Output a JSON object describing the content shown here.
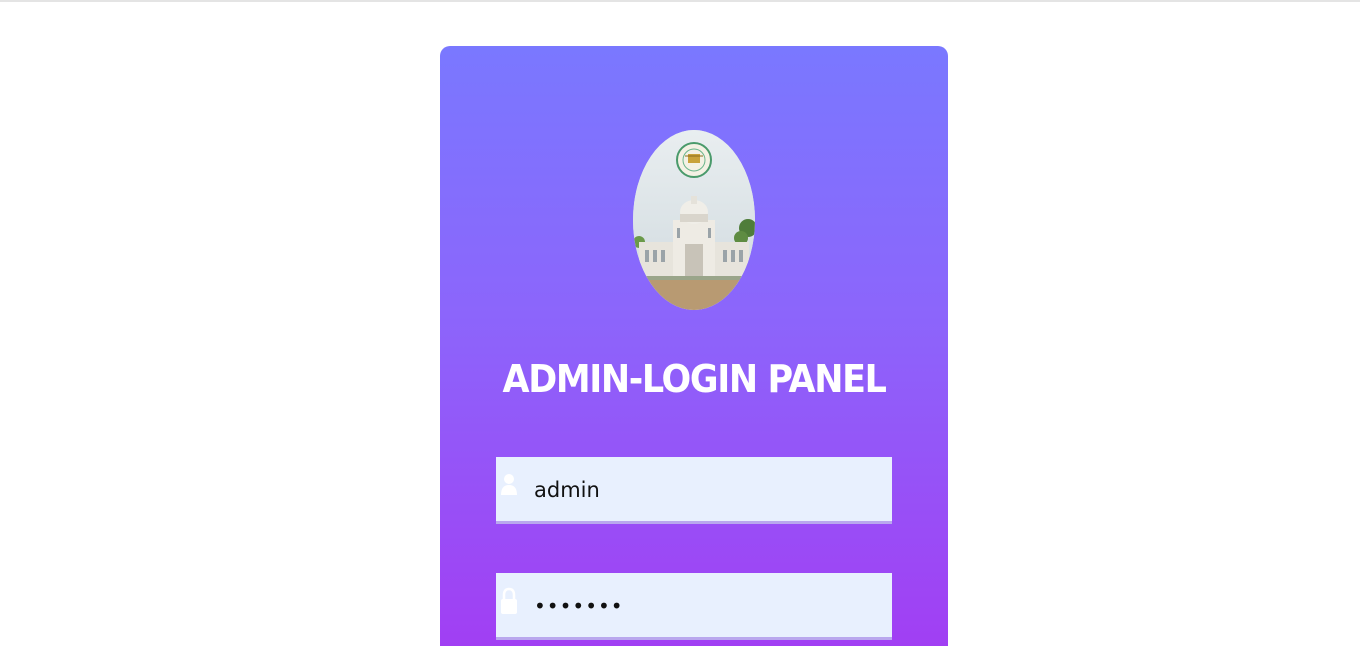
{
  "panel": {
    "title": "ADMIN-LOGIN PANEL"
  },
  "form": {
    "username": {
      "value": "admin",
      "icon": "user-icon"
    },
    "password": {
      "value": "•••••••",
      "icon": "lock-icon"
    }
  },
  "colors": {
    "gradient_top": "#7a78ff",
    "gradient_bottom": "#a13ff3",
    "field_bg": "#e8f0fe"
  }
}
